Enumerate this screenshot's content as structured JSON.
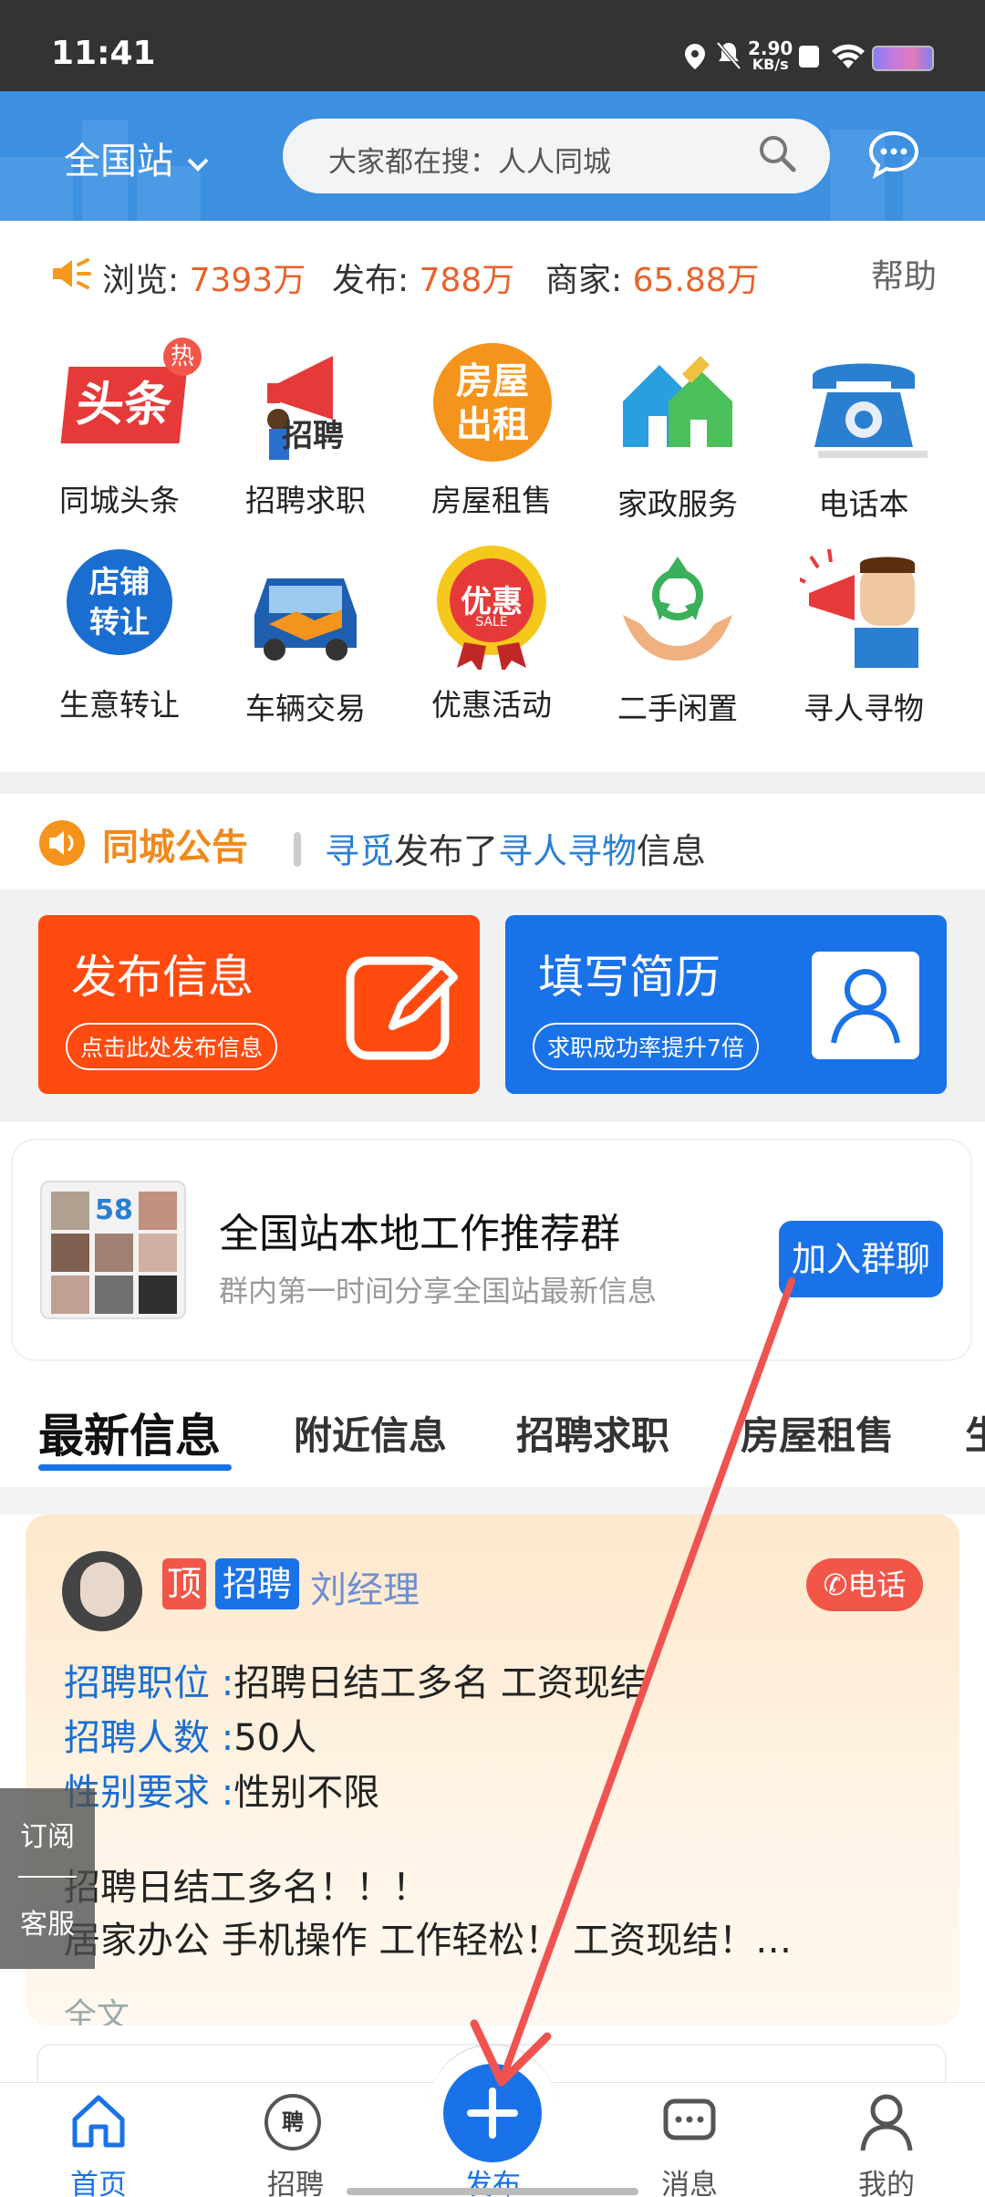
{
  "status_bar": {
    "time": "11:41",
    "net_speed": "2.90",
    "net_unit": "KB/s"
  },
  "header": {
    "city": "全国站",
    "search_placeholder": "大家都在搜：人人同城"
  },
  "stats": {
    "views_label": "浏览:",
    "views_value": "7393万",
    "posts_label": "发布:",
    "posts_value": "788万",
    "merchants_label": "商家:",
    "merchants_value": "65.88万",
    "help": "帮助"
  },
  "grid": [
    {
      "label": "同城头条",
      "icon_text": "头条",
      "badge": "热"
    },
    {
      "label": "招聘求职",
      "icon_text": "招聘"
    },
    {
      "label": "房屋租售",
      "icon_text": "房屋出租"
    },
    {
      "label": "家政服务"
    },
    {
      "label": "电话本"
    },
    {
      "label": "生意转让",
      "icon_text": "店铺转让"
    },
    {
      "label": "车辆交易"
    },
    {
      "label": "优惠活动",
      "icon_text": "优惠",
      "icon_sub": "SALE"
    },
    {
      "label": "二手闲置"
    },
    {
      "label": "寻人寻物"
    }
  ],
  "notice": {
    "title": "同城公告",
    "user": "寻觅",
    "mid": "发布了",
    "category": "寻人寻物",
    "tail": "信息"
  },
  "actions": {
    "publish_title": "发布信息",
    "publish_sub": "点击此处发布信息",
    "resume_title": "填写简历",
    "resume_sub": "求职成功率提升7倍"
  },
  "group": {
    "title": "全国站本地工作推荐群",
    "subtitle": "群内第一时间分享全国站最新信息",
    "join": "加入群聊",
    "logo": "58"
  },
  "tabs": [
    "最新信息",
    "附近信息",
    "招聘求职",
    "房屋租售",
    "生"
  ],
  "post": {
    "tag_top": "顶",
    "tag_category": "招聘",
    "author": "刘经理",
    "call": "电话",
    "fields": [
      {
        "key": "招聘职位 :",
        "value": "招聘日结工多名 工资现结"
      },
      {
        "key": "招聘人数 :",
        "value": "50人"
      },
      {
        "key": "性别要求 :",
        "value": "性别不限"
      }
    ],
    "desc1": "招聘日结工多名！！！",
    "desc2": "居家办公 手机操作 工作轻松！ 工资现结！…",
    "full": "全文"
  },
  "side": {
    "subscribe": "订阅",
    "service": "客服"
  },
  "bottom_nav": {
    "home": "首页",
    "jobs": "招聘",
    "jobs_icon": "聘",
    "publish": "发布",
    "messages": "消息",
    "mine": "我的"
  },
  "colors": {
    "primary": "#1a72e8",
    "header": "#3d8fe0",
    "accent_orange": "#ff4a10",
    "stat_value": "#e8622c",
    "arrow": "#ef5350"
  }
}
